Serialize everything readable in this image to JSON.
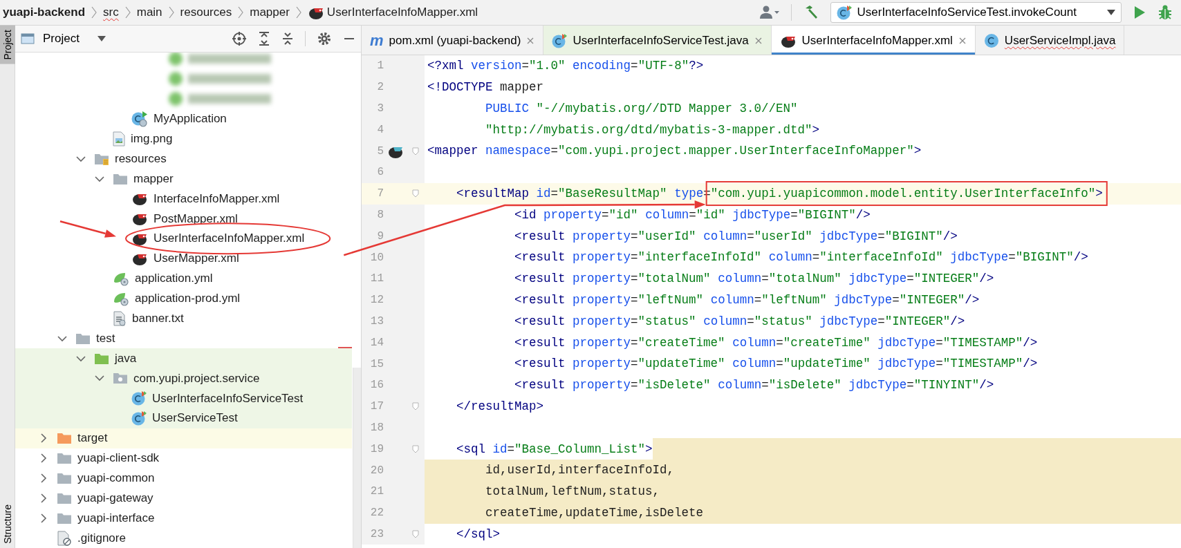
{
  "breadcrumbs": [
    {
      "label": "yuapi-backend",
      "kind": "module",
      "error": false
    },
    {
      "label": "src",
      "kind": "folder",
      "error": true
    },
    {
      "label": "main",
      "kind": "folder",
      "error": false
    },
    {
      "label": "resources",
      "kind": "folder",
      "error": false
    },
    {
      "label": "mapper",
      "kind": "folder",
      "error": false
    },
    {
      "label": "UserInterfaceInfoMapper.xml",
      "kind": "mybatis-file",
      "error": false
    }
  ],
  "toolbar": {
    "run_config": "UserInterfaceInfoServiceTest.invokeCount"
  },
  "tool_strip": [
    {
      "label": "Project",
      "selected": true
    },
    {
      "label": "Structure",
      "selected": false
    }
  ],
  "project_panel": {
    "title": "Project",
    "tree": [
      {
        "children": [
          {
            "children": [
              {
                "children": [
                  {
                    "children": [
                      {
                        "children": [
                          {
                            "children": [
                              {
                                "kind": "blurred"
                              },
                              {
                                "kind": "blurred"
                              },
                              {
                                "kind": "blurred"
                              }
                            ]
                          }
                        ]
                      },
                      {
                        "label": "MyApplication",
                        "kind": "spring-class"
                      }
                    ]
                  },
                  {
                    "label": "img.png",
                    "kind": "image"
                  }
                ]
              },
              {
                "label": "resources",
                "kind": "resources-folder",
                "expanded": true,
                "children": [
                  {
                    "label": "mapper",
                    "kind": "folder",
                    "expanded": true,
                    "children": [
                      {
                        "label": "InterfaceInfoMapper.xml",
                        "kind": "mybatis-xml"
                      },
                      {
                        "label": "PostMapper.xml",
                        "kind": "mybatis-xml"
                      },
                      {
                        "label": "UserInterfaceInfoMapper.xml",
                        "kind": "mybatis-xml",
                        "circled": true
                      },
                      {
                        "label": "UserMapper.xml",
                        "kind": "mybatis-xml"
                      }
                    ]
                  },
                  {
                    "label": "application.yml",
                    "kind": "yml"
                  },
                  {
                    "label": "application-prod.yml",
                    "kind": "yml"
                  },
                  {
                    "label": "banner.txt",
                    "kind": "text"
                  }
                ]
              }
            ]
          },
          {
            "label": "test",
            "kind": "folder",
            "expanded": true,
            "children": [
              {
                "label": "java",
                "kind": "test-source-folder",
                "expanded": true,
                "color": "#eef6e6",
                "children": [
                  {
                    "label": "com.yupi.project.service",
                    "kind": "package",
                    "expanded": true,
                    "color": "#eef6e6",
                    "children": [
                      {
                        "label": "UserInterfaceInfoServiceTest",
                        "kind": "test-class",
                        "color": "#eef6e6"
                      },
                      {
                        "label": "UserServiceTest",
                        "kind": "test-class",
                        "color": "#eef6e6"
                      }
                    ]
                  }
                ]
              }
            ]
          }
        ]
      },
      {
        "label": "target",
        "kind": "excluded-folder",
        "expanded": false,
        "color": "#fcfbe6"
      },
      {
        "label": "yuapi-client-sdk",
        "kind": "folder",
        "expanded": false
      },
      {
        "label": "yuapi-common",
        "kind": "folder",
        "expanded": false
      },
      {
        "label": "yuapi-gateway",
        "kind": "folder",
        "expanded": false
      },
      {
        "label": "yuapi-interface",
        "kind": "folder",
        "expanded": false
      },
      {
        "label": ".gitignore",
        "kind": "gitignore"
      }
    ]
  },
  "editor": {
    "tabs": [
      {
        "label": "pom.xml (yuapi-backend)",
        "kind": "maven",
        "icon_text": "m",
        "selected": false,
        "error": false,
        "close_button": true
      },
      {
        "label": "UserInterfaceInfoServiceTest.java",
        "kind": "test-class",
        "selected": false,
        "error": false,
        "close_button": true
      },
      {
        "label": "UserInterfaceInfoMapper.xml",
        "kind": "mybatis-xml",
        "selected": true,
        "error": false,
        "close_button": true
      },
      {
        "label": "UserServiceImpl.java",
        "kind": "class",
        "selected": false,
        "error": true
      }
    ],
    "lines": [
      {
        "number": "1",
        "kind": "plain",
        "text": "<?xml version=\"1.0\" encoding=\"UTF-8\"?>"
      },
      {
        "number": "2",
        "kind": "plain",
        "text": "<!DOCTYPE mapper"
      },
      {
        "number": "3",
        "kind": "plain",
        "text": "        PUBLIC \"-//mybatis.org//DTD Mapper 3.0//EN\""
      },
      {
        "number": "4",
        "kind": "plain",
        "text": "        \"http://mybatis.org/dtd/mybatis-3-mapper.dtd\">"
      },
      {
        "number": "5",
        "kind": "plain",
        "text": "<mapper namespace=\"com.yupi.project.mapper.UserInterfaceInfoMapper\">",
        "fold": true,
        "marker": true
      },
      {
        "number": "6",
        "kind": "plain"
      },
      {
        "number": "7",
        "kind": "current",
        "text": "    <resultMap id=\"BaseResultMap\" type=\"com.yupi.yuapicommon.model.entity.UserInterfaceInfo\">",
        "fold": true,
        "boxed": true
      },
      {
        "number": "8",
        "kind": "plain",
        "text": "            <id property=\"id\" column=\"id\" jdbcType=\"BIGINT\"/>"
      },
      {
        "number": "9",
        "kind": "plain",
        "text": "            <result property=\"userId\" column=\"userId\" jdbcType=\"BIGINT\"/>"
      },
      {
        "number": "10",
        "kind": "plain",
        "text": "            <result property=\"interfaceInfoId\" column=\"interfaceInfoId\" jdbcType=\"BIGINT\"/>"
      },
      {
        "number": "11",
        "kind": "plain",
        "text": "            <result property=\"totalNum\" column=\"totalNum\" jdbcType=\"INTEGER\"/>"
      },
      {
        "number": "12",
        "kind": "plain",
        "text": "            <result property=\"leftNum\" column=\"leftNum\" jdbcType=\"INTEGER\"/>"
      },
      {
        "number": "13",
        "kind": "plain",
        "text": "            <result property=\"status\" column=\"status\" jdbcType=\"INTEGER\"/>"
      },
      {
        "number": "14",
        "kind": "plain",
        "text": "            <result property=\"createTime\" column=\"createTime\" jdbcType=\"TIMESTAMP\"/>"
      },
      {
        "number": "15",
        "kind": "plain",
        "text": "            <result property=\"updateTime\" column=\"updateTime\" jdbcType=\"TIMESTAMP\"/>"
      },
      {
        "number": "16",
        "kind": "plain",
        "text": "            <result property=\"isDelete\" column=\"isDelete\" jdbcType=\"TINYINT\"/>"
      },
      {
        "number": "17",
        "kind": "plain",
        "text": "    </resultMap>",
        "fold": true
      },
      {
        "number": "18",
        "kind": "plain"
      },
      {
        "number": "19",
        "kind": "fragment-start",
        "text": "    <sql id=\"Base_Column_List\">",
        "fold": true
      },
      {
        "number": "20",
        "kind": "fragment",
        "text": "        id,userId,interfaceInfoId,"
      },
      {
        "number": "21",
        "kind": "fragment",
        "text": "        totalNum,leftNum,status,"
      },
      {
        "number": "22",
        "kind": "fragment",
        "text": "        createTime,updateTime,isDelete"
      },
      {
        "number": "23",
        "kind": "plain",
        "text": "    </sql>",
        "fold": true
      }
    ]
  }
}
